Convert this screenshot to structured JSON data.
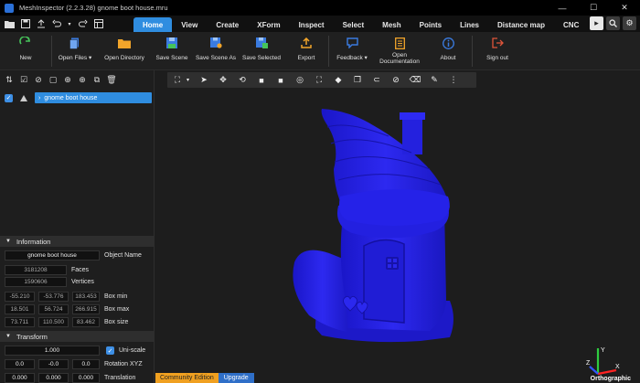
{
  "window": {
    "title": "MeshInspector (2.2.3.28) gnome boot house.mru",
    "controls": [
      "—",
      "☐",
      "✕"
    ]
  },
  "quick_access": [
    "folder-icon",
    "save-icon",
    "export-icon",
    "undo-icon",
    "redo-icon",
    "layout-icon"
  ],
  "tabs": [
    {
      "label": "Home",
      "active": true
    },
    {
      "label": "View",
      "active": false
    },
    {
      "label": "Create",
      "active": false
    },
    {
      "label": "XForm",
      "active": false
    },
    {
      "label": "Inspect",
      "active": false
    },
    {
      "label": "Select",
      "active": false
    },
    {
      "label": "Mesh",
      "active": false
    },
    {
      "label": "Points",
      "active": false
    },
    {
      "label": "Lines",
      "active": false
    },
    {
      "label": "Distance map",
      "active": false
    },
    {
      "label": "CNC",
      "active": false
    }
  ],
  "ribbon": {
    "new": "New",
    "open_files": "Open Files",
    "open_directory": "Open Directory",
    "save_scene": "Save Scene",
    "save_scene_as": "Save Scene As",
    "save_selected": "Save Selected",
    "export": "Export",
    "feedback": "Feedback",
    "open_documentation_1": "Open",
    "open_documentation_2": "Documentation",
    "about": "About",
    "sign_out": "Sign out"
  },
  "scene_tree": {
    "object_name": "gnome boot house"
  },
  "information": {
    "header": "Information",
    "object_name_value": "gnome boot house",
    "object_name_label": "Object Name",
    "faces_value": "3181208",
    "faces_label": "Faces",
    "vertices_value": "1590606",
    "vertices_label": "Vertices",
    "box_min": [
      "-55.210",
      "-53.776",
      "183.453"
    ],
    "box_min_label": "Box min",
    "box_max": [
      "18.501",
      "56.724",
      "266.915"
    ],
    "box_max_label": "Box max",
    "box_size": [
      "73.711",
      "110.500",
      "83.462"
    ],
    "box_size_label": "Box size"
  },
  "transform": {
    "header": "Transform",
    "uniscale_value": "1.000",
    "uniscale_label": "Uni-scale",
    "rotation": [
      "0.0",
      "-0.0",
      "0.0"
    ],
    "rotation_label": "Rotation XYZ",
    "translation": [
      "0.000",
      "0.000",
      "0.000"
    ],
    "translation_label": "Translation"
  },
  "viewport": {
    "edition": "Community Edition",
    "upgrade": "Upgrade",
    "projection": "Orthographic",
    "axis_x": "X",
    "axis_y": "Y",
    "axis_z": "Z"
  },
  "colors": {
    "accent": "#2f8de0",
    "mesh": "#2420e8",
    "edition_banner": "#f0a020"
  }
}
